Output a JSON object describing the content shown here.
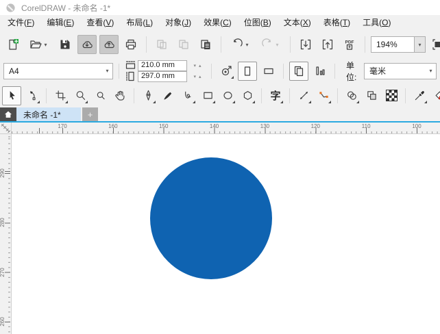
{
  "app": {
    "title": "CorelDRAW - 未命名 -1*"
  },
  "menu": {
    "items": [
      "文件(F)",
      "编辑(E)",
      "查看(V)",
      "布局(L)",
      "对象(J)",
      "效果(C)",
      "位图(B)",
      "文本(X)",
      "表格(T)",
      "工具(O)"
    ]
  },
  "toolbar": {
    "zoom_level": "194%",
    "pdf_label": "PDF",
    "icons": [
      "new-document",
      "open",
      "save",
      "cloud-download",
      "cloud-upload",
      "print",
      "paste-special",
      "copy",
      "paste",
      "undo",
      "redo",
      "import",
      "export",
      "publish-to-pdf",
      "zoom-level",
      "full-screen-preview",
      "show-rulers"
    ]
  },
  "property_bar": {
    "page_size_value": "A4",
    "page_width_value": "210.0 mm",
    "page_height_value": "297.0 mm",
    "units_label": "单位:",
    "units_value": "毫米"
  },
  "toolbox": {
    "text_tool_glyph": "字",
    "tools": [
      "pick",
      "shape",
      "crop",
      "zoom",
      "zoom-secondary",
      "pan",
      "pen",
      "paint",
      "b-spline",
      "rectangle",
      "ellipse",
      "polygon",
      "text",
      "dimension",
      "connector",
      "drop-shadow",
      "transparency",
      "pattern-fill",
      "color-eyedropper",
      "interactive-fill",
      "smart-fill-partial"
    ]
  },
  "tabs": {
    "active": "未命名 -1*",
    "new_tab": "+"
  },
  "rulers": {
    "horizontal_labels": [
      "170",
      "160",
      "150",
      "140",
      "130",
      "120",
      "110",
      "100"
    ],
    "vertical_labels": [
      "290",
      "280",
      "270",
      "260"
    ]
  },
  "canvas": {
    "shape": {
      "type": "ellipse",
      "fill": "#0F63B1"
    }
  },
  "icons": {
    "caret_down": "▾",
    "spinner_down": "▾",
    "spinner_up": "▴"
  },
  "colors": {
    "accent": "#2AA9E0",
    "tab_active_bg": "#CEE3F6",
    "circle_fill": "#0F63B1"
  }
}
